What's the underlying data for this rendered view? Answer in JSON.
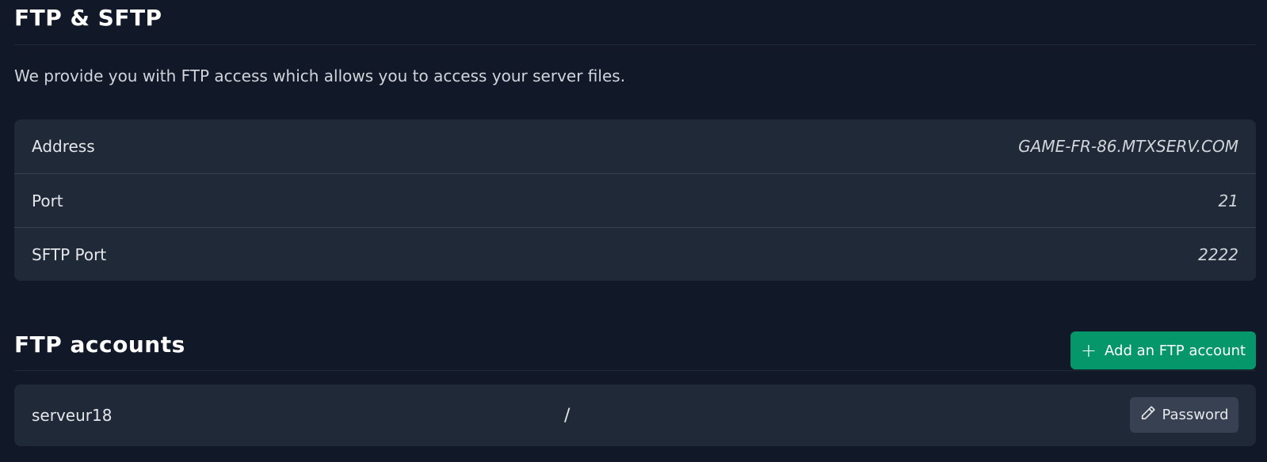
{
  "ftp_section": {
    "title": "FTP & SFTP",
    "description": "We provide you with FTP access which allows you to access your server files."
  },
  "connection_info": [
    {
      "label": "Address",
      "value": "GAME-FR-86.MTXSERV.COM"
    },
    {
      "label": "Port",
      "value": "21"
    },
    {
      "label": "SFTP Port",
      "value": "2222"
    }
  ],
  "accounts_section": {
    "title": "FTP accounts",
    "add_button_label": "Add an FTP account",
    "add_button_icon": "plus-icon",
    "accent_color": "#059669"
  },
  "accounts": [
    {
      "username": "serveur18",
      "path": "/",
      "password_button_label": "Password",
      "password_button_icon": "pencil-icon"
    }
  ]
}
